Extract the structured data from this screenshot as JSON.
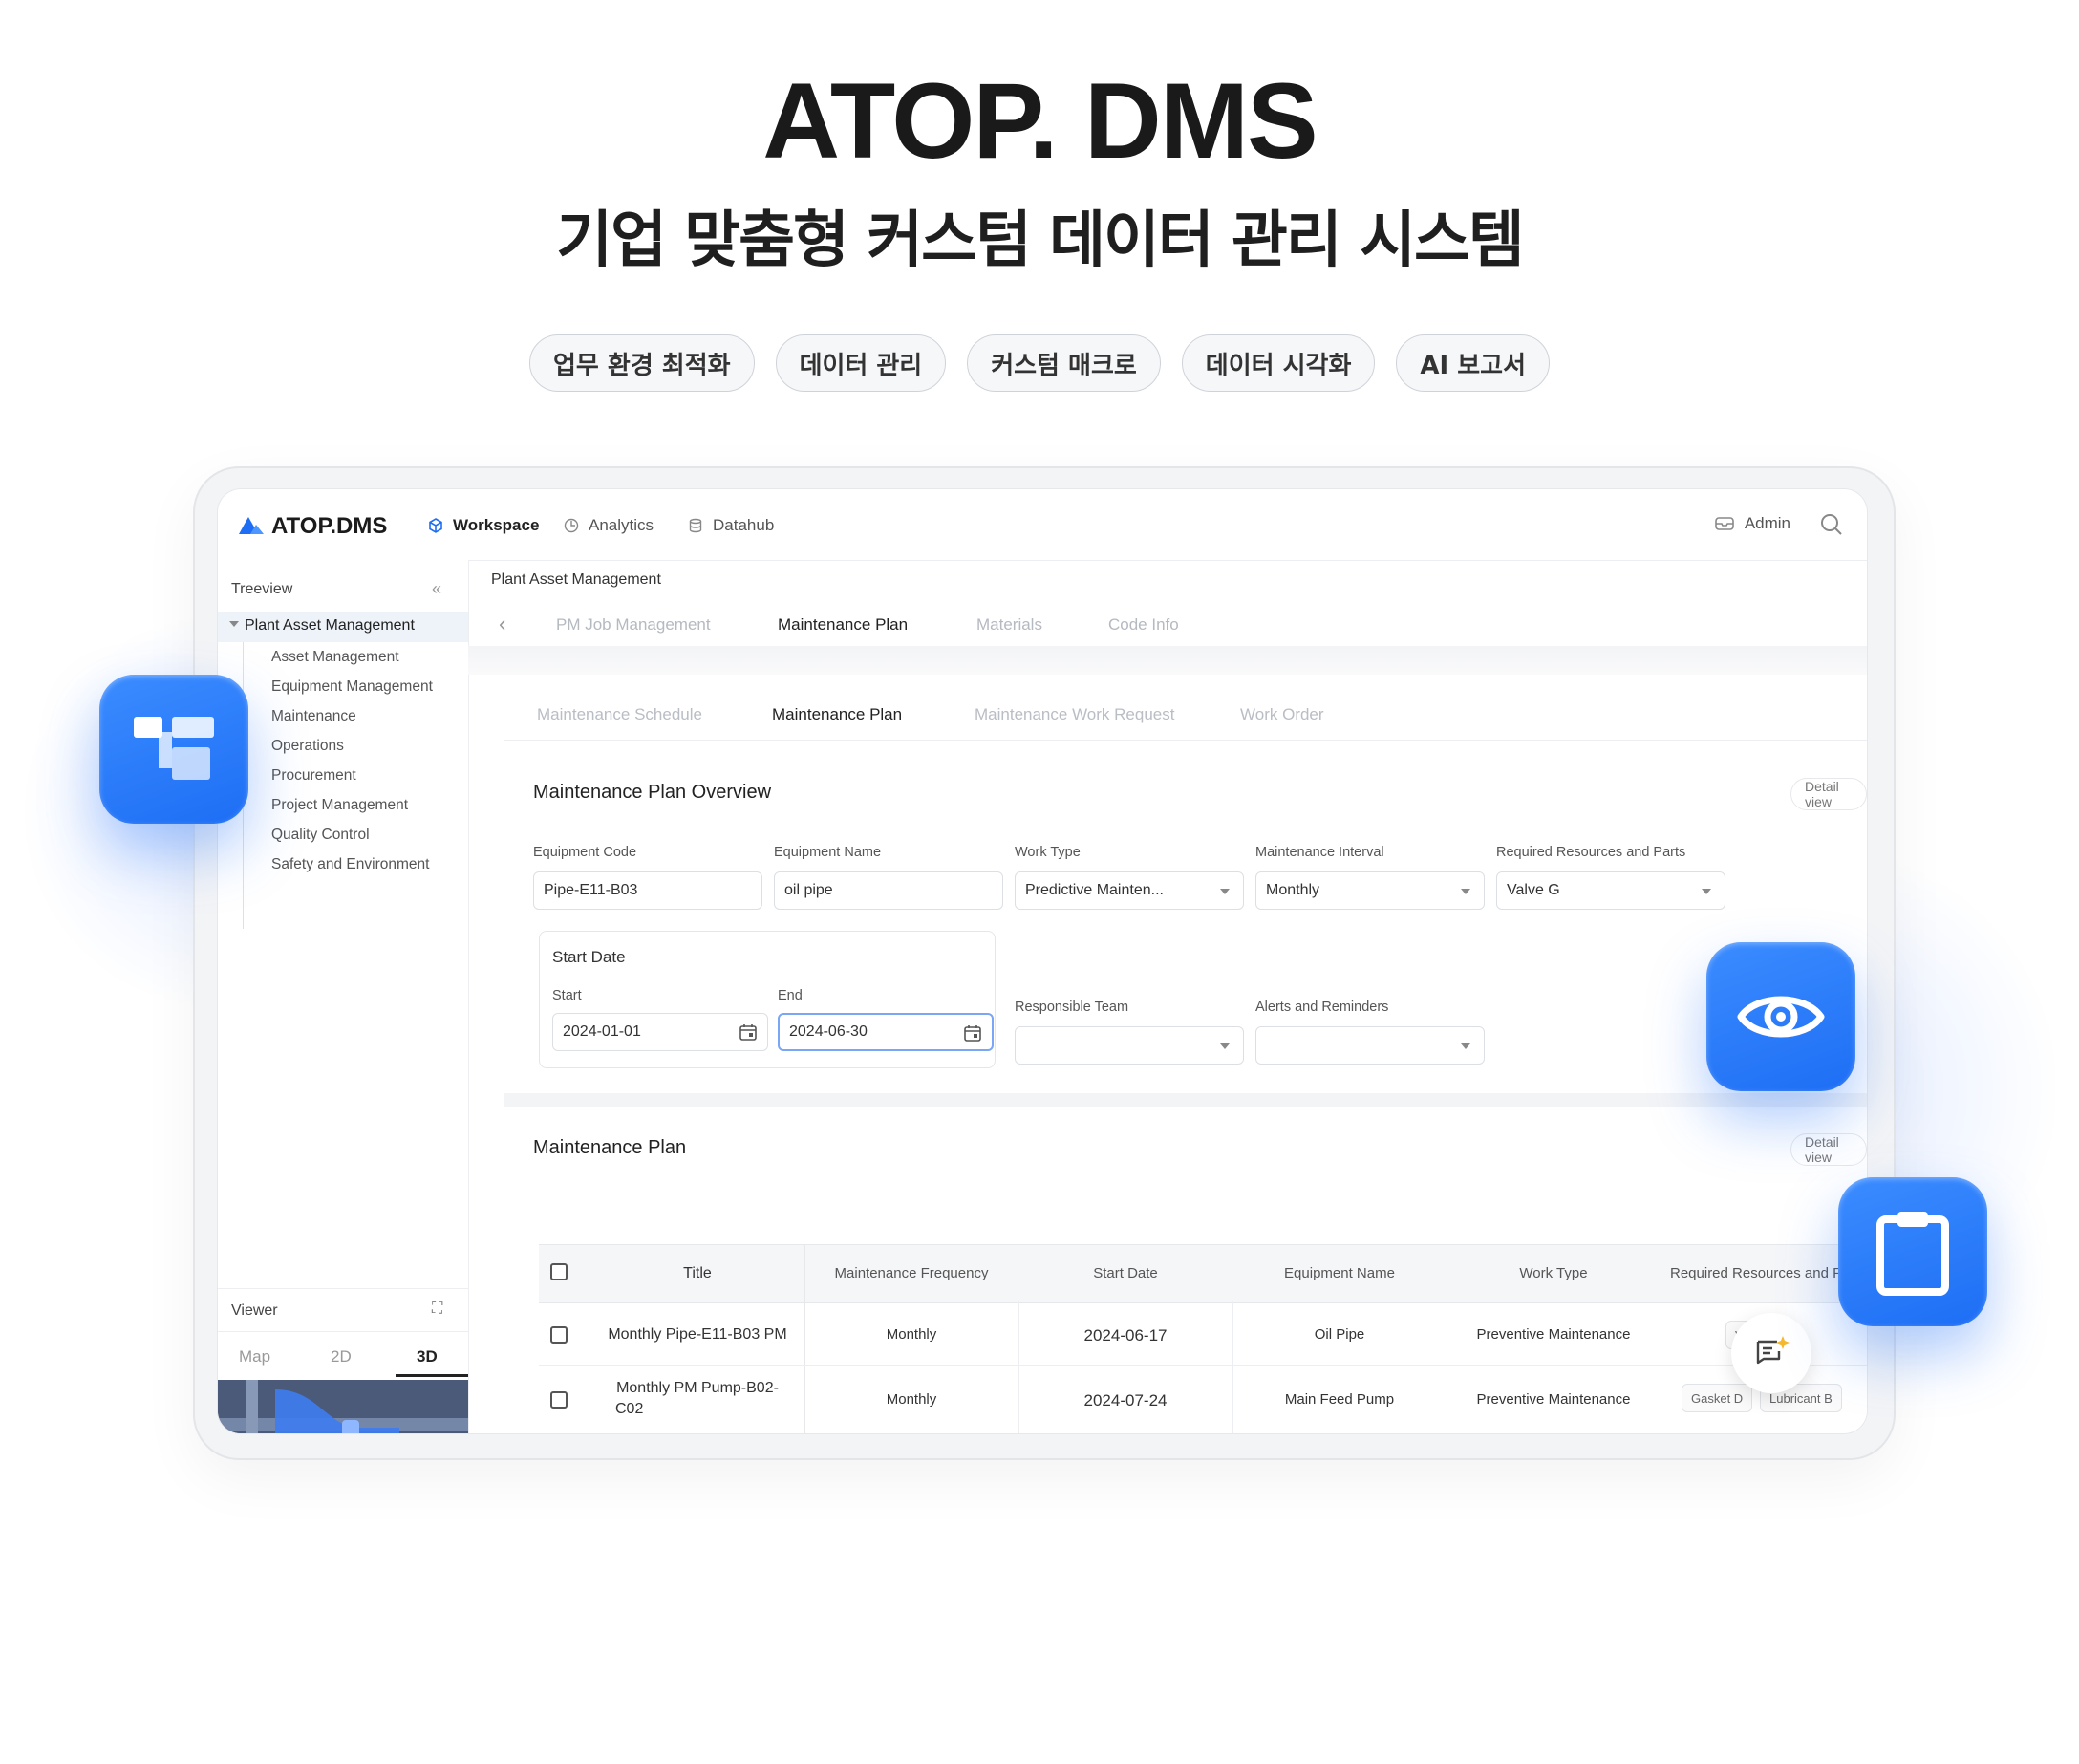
{
  "hero": {
    "title": "ATOP. DMS",
    "subtitle": "기업 맞춤형 커스텀 데이터 관리 시스템",
    "tags": [
      "업무 환경 최적화",
      "데이터 관리",
      "커스텀 매크로",
      "데이터 시각화",
      "AI 보고서"
    ]
  },
  "app": {
    "logo": "ATOP.DMS",
    "nav": [
      {
        "label": "Workspace",
        "icon": "cube-icon"
      },
      {
        "label": "Analytics",
        "icon": "clock-chart-icon"
      },
      {
        "label": "Datahub",
        "icon": "database-icon"
      }
    ],
    "user": "Admin",
    "accent": "#1e6ef5"
  },
  "sidebar": {
    "header": "Treeview",
    "collapse": "«",
    "root": "Plant Asset Management",
    "items": [
      "Asset Management",
      "Equipment Management",
      "Maintenance",
      "Operations",
      "Procurement",
      "Project Management",
      "Quality Control",
      "Safety and Environment"
    ],
    "viewer": {
      "label": "Viewer",
      "expand": "⛶",
      "tabs": [
        "Map",
        "2D",
        "3D"
      ]
    }
  },
  "main": {
    "breadcrumb": "Plant Asset Management",
    "back": "‹",
    "tabs": [
      "PM Job Management",
      "Maintenance Plan",
      "Materials",
      "Code Info"
    ],
    "subtabs": [
      "Maintenance Schedule",
      "Maintenance Plan",
      "Maintenance Work Request",
      "Work Order"
    ],
    "overview": {
      "title": "Maintenance Plan Overview",
      "detail": "Detail view",
      "fields": {
        "equipment_code": {
          "label": "Equipment Code",
          "value": "Pipe-E11-B03"
        },
        "equipment_name": {
          "label": "Equipment Name",
          "value": "oil pipe"
        },
        "work_type": {
          "label": "Work Type",
          "value": "Predictive Mainten..."
        },
        "interval": {
          "label": "Maintenance Interval",
          "value": "Monthly"
        },
        "resources": {
          "label": "Required Resources and Parts",
          "value": "Valve G"
        },
        "start_date": {
          "label": "Start Date",
          "start_label": "Start",
          "start": "2024-01-01",
          "end_label": "End",
          "end": "2024-06-30"
        },
        "team": {
          "label": "Responsible Team",
          "value": ""
        },
        "alerts": {
          "label": "Alerts and Reminders",
          "value": ""
        }
      }
    },
    "plan": {
      "title": "Maintenance Plan",
      "detail": "Detail view",
      "columns": [
        "Title",
        "Maintenance Frequency",
        "Start Date",
        "Equipment Name",
        "Work Type",
        "Required Resources and P"
      ],
      "rows": [
        {
          "title": "Monthly Pipe-E11-B03 PM",
          "frequency": "Monthly",
          "start": "2024-06-17",
          "equipment": "Oil Pipe",
          "work_type": "Preventive Maintenance",
          "resources": [
            "V"
          ]
        },
        {
          "title_1": "Monthly PM Pump-B02-",
          "title_2": "C02",
          "frequency": "Monthly",
          "start": "2024-07-24",
          "equipment": "Main Feed Pump",
          "work_type": "Preventive Maintenance",
          "resources": [
            "Gasket D",
            "Lubricant B"
          ]
        }
      ]
    }
  },
  "floating": [
    "hierarchy-icon",
    "eye-icon",
    "clipboard-icon",
    "ai-chat-icon"
  ]
}
